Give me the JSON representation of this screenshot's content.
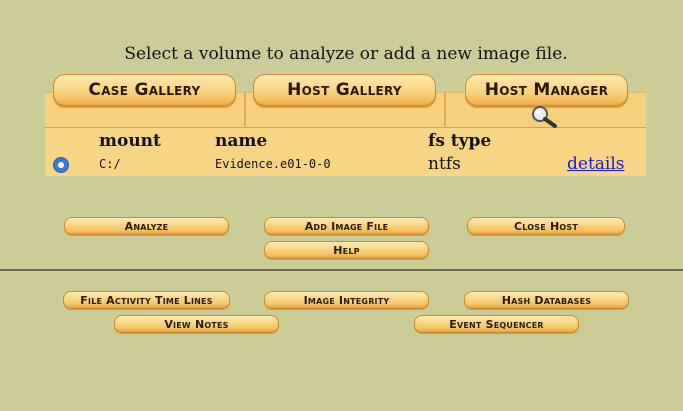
{
  "instruction": "Select a volume to analyze or add a new image file.",
  "tabs": {
    "case_gallery": "Case Gallery",
    "host_gallery": "Host Gallery",
    "host_manager": "Host Manager"
  },
  "table": {
    "headers": {
      "mount": "mount",
      "name": "name",
      "fs_type": "fs type"
    },
    "rows": [
      {
        "selected": true,
        "mount": "C:/",
        "name": "Evidence.e01-0-0",
        "fs_type": "ntfs",
        "details": "details"
      }
    ]
  },
  "actions": {
    "analyze": "Analyze",
    "add_image_file": "Add Image File",
    "close_host": "Close Host",
    "help": "Help"
  },
  "tools": {
    "file_activity_time_lines": "File Activity Time Lines",
    "image_integrity": "Image Integrity",
    "hash_databases": "Hash Databases",
    "view_notes": "View Notes",
    "event_sequencer": "Event Sequencer"
  },
  "colors": {
    "background": "#cccc99",
    "tab_bar": "#f6d07c",
    "button_gold": "#f6c466",
    "link": "#1a1ad0",
    "radio": "#3b7cd9"
  },
  "icons": {
    "host_manager_icon": "magnifier-icon"
  }
}
